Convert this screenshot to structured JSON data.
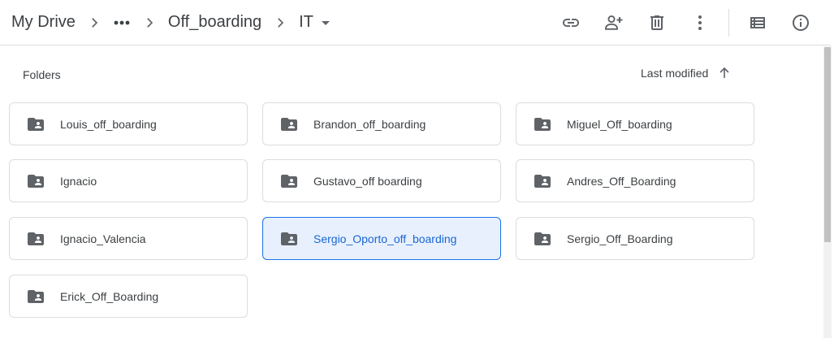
{
  "breadcrumb": {
    "root": "My Drive",
    "parent": "Off_boarding",
    "current": "IT"
  },
  "icons": {
    "chevron": "chevron-right-icon",
    "more": "more-horiz-icon",
    "caret": "arrow-drop-down-icon",
    "link": "link-icon",
    "share": "person-add-icon",
    "delete": "trash-icon",
    "more_vert": "more-vert-icon",
    "list_view": "list-view-icon",
    "details": "info-icon",
    "folder": "shared-folder-icon",
    "sort": "arrow-up-icon"
  },
  "colors": {
    "text": "#3c4043",
    "icon": "#5f6368",
    "border": "#dadce0",
    "selected_bg": "#e8f0fe",
    "selected_border": "#1a73e8",
    "selected_text": "#1967d2"
  },
  "folders_section": {
    "label": "Folders",
    "sort_label": "Last modified",
    "sort_direction": "ascending"
  },
  "folders": [
    {
      "name": "Louis_off_boarding",
      "selected": false
    },
    {
      "name": "Brandon_off_boarding",
      "selected": false
    },
    {
      "name": "Miguel_Off_boarding",
      "selected": false
    },
    {
      "name": "Ignacio",
      "selected": false
    },
    {
      "name": "Gustavo_off boarding",
      "selected": false
    },
    {
      "name": "Andres_Off_Boarding",
      "selected": false
    },
    {
      "name": "Ignacio_Valencia",
      "selected": false
    },
    {
      "name": "Sergio_Oporto_off_boarding",
      "selected": true
    },
    {
      "name": "Sergio_Off_Boarding",
      "selected": false
    },
    {
      "name": "Erick_Off_Boarding",
      "selected": false
    }
  ]
}
